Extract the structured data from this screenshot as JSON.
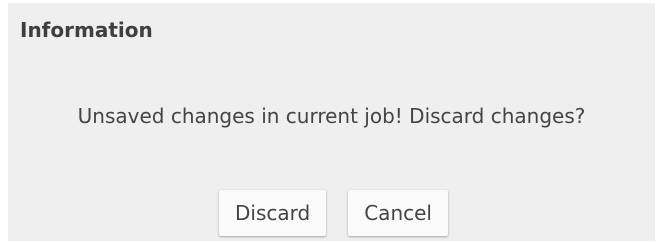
{
  "dialog": {
    "title": "Information",
    "message": "Unsaved changes in current job! Discard changes?",
    "buttons": {
      "discard_label": "Discard",
      "cancel_label": "Cancel"
    }
  }
}
